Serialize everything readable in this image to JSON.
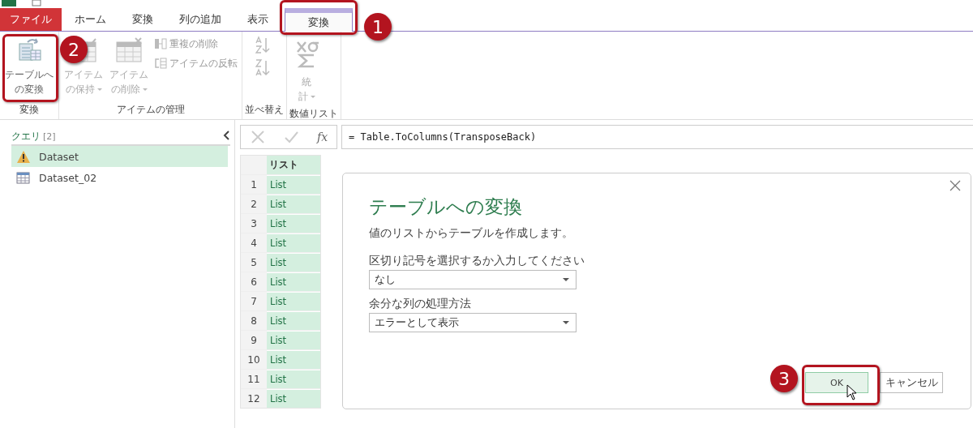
{
  "tabs": [
    {
      "label": "ファイル",
      "kind": "file",
      "selected": false
    },
    {
      "label": "ホーム",
      "kind": "normal",
      "selected": false
    },
    {
      "label": "変換",
      "kind": "normal",
      "selected": false
    },
    {
      "label": "列の追加",
      "kind": "normal",
      "selected": false
    },
    {
      "label": "表示",
      "kind": "normal",
      "selected": false
    },
    {
      "label": "変換",
      "kind": "contextual",
      "selected": true
    }
  ],
  "ribbon": {
    "groups": [
      {
        "label": "変換",
        "buttons": [
          {
            "kind": "large",
            "lines": [
              "テーブルへ",
              "の変換"
            ],
            "dropdown": false,
            "disabled": false
          }
        ]
      },
      {
        "label": "アイテムの管理",
        "buttons": [
          {
            "kind": "large",
            "lines": [
              "アイテム",
              "の保持"
            ],
            "dropdown": true,
            "disabled": true
          },
          {
            "kind": "large",
            "lines": [
              "アイテム",
              "の削除"
            ],
            "dropdown": true,
            "disabled": true
          },
          {
            "kind": "small",
            "lines": [
              "重複の削除",
              "アイテムの反転"
            ],
            "disabled": true
          }
        ]
      },
      {
        "label": "並べ替え",
        "buttons": [
          {
            "kind": "sort",
            "disabled": true
          }
        ]
      },
      {
        "label": "数値リスト",
        "buttons": [
          {
            "kind": "large",
            "lines": [
              "統",
              "計"
            ],
            "dropdown": true,
            "disabled": true
          }
        ]
      }
    ]
  },
  "queries": {
    "title": "クエリ",
    "count": "[2]",
    "items": [
      {
        "name": "Dataset",
        "kind": "warning",
        "selected": true
      },
      {
        "name": "Dataset_02",
        "kind": "table",
        "selected": false
      }
    ]
  },
  "formula_bar": {
    "fx": "fx",
    "formula": "= Table.ToColumns(TransposeBack)"
  },
  "table": {
    "column": "リスト",
    "rows": [
      {
        "index": "1",
        "value": "List"
      },
      {
        "index": "2",
        "value": "List"
      },
      {
        "index": "3",
        "value": "List"
      },
      {
        "index": "4",
        "value": "List"
      },
      {
        "index": "5",
        "value": "List"
      },
      {
        "index": "6",
        "value": "List"
      },
      {
        "index": "7",
        "value": "List"
      },
      {
        "index": "8",
        "value": "List"
      },
      {
        "index": "9",
        "value": "List"
      },
      {
        "index": "10",
        "value": "List"
      },
      {
        "index": "11",
        "value": "List"
      },
      {
        "index": "12",
        "value": "List"
      }
    ]
  },
  "dialog": {
    "title": "テーブルへの変換",
    "description": "値のリストからテーブルを作成します。",
    "fields": [
      {
        "label": "区切り記号を選択するか入力してください",
        "value": "なし"
      },
      {
        "label": "余分な列の処理方法",
        "value": "エラーとして表示"
      }
    ],
    "buttons": [
      {
        "label": "OK",
        "focused": true
      },
      {
        "label": "キャンセル",
        "focused": false
      }
    ]
  },
  "callouts": [
    {
      "label": "1"
    },
    {
      "label": "2"
    },
    {
      "label": "3"
    }
  ]
}
